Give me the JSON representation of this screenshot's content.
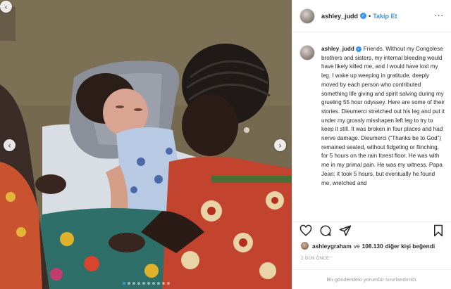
{
  "post": {
    "username": "ashley_judd",
    "follow_label": "Takip Et",
    "separator": "•",
    "more_label": "···",
    "caption": "Friends. Without my Congolese brothers and sisters, my internal bleeding would have likely killed me, and I would have lost my leg. I wake up weeping in gratitude, deeply moved by each person who contributed something life giving and spirit salving during my grueling 55 hour odyssey. Here are some of their stories. Dieumerci stretched out his leg and put it under my grossly misshapen left leg to try to keep it still. It was broken in four places and had nerve damage. Dieumerci (“Thanks be to God”) remained seated, without fidgeting or flinching, for 5 hours on the rain forest floor. He was with me in my primal pain. He was my witness. Papa Jean: it took 5 hours, but eventually he found me, wretched and",
    "liked_by_user": "ashleygraham",
    "liked_connector": "ve",
    "liked_count": "108.130",
    "liked_suffix": "diğer kişi beğendi",
    "date": "2 GÜN ÖNCE",
    "comments_limited": "Bu gönderideki yorumlar sınırlandırıldı."
  },
  "carousel": {
    "arrow_prev": "‹",
    "arrow_next": "›",
    "dot_count": 10,
    "active_index": 0
  },
  "icons": {
    "verified": "✓",
    "like": "heart-icon",
    "comment": "comment-icon",
    "share": "share-icon",
    "save": "bookmark-icon"
  },
  "colors": {
    "accent": "#3897f0",
    "text": "#262626",
    "muted": "#8e8e8e",
    "border": "#efefef"
  }
}
